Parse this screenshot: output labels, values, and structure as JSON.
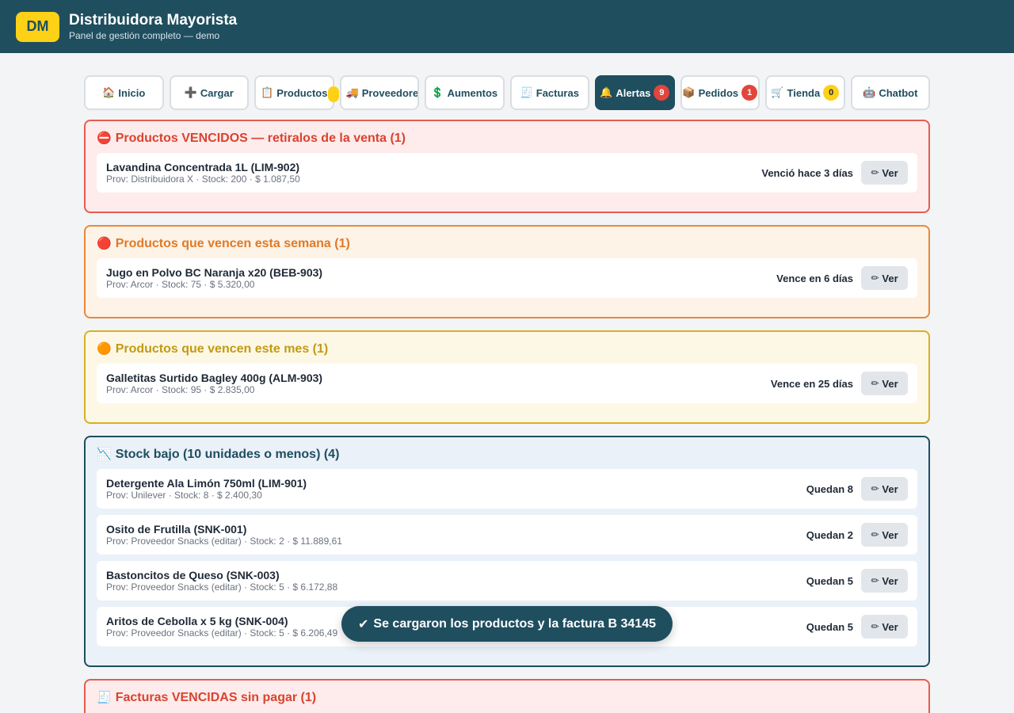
{
  "app": {
    "logo": "DM",
    "title": "Distribuidora Mayorista",
    "subtitle": "Panel de gestión completo — demo"
  },
  "nav": {
    "tabs": [
      {
        "icon": "🏠",
        "label": "Inicio"
      },
      {
        "icon": "➕",
        "label": "Cargar"
      },
      {
        "icon": "📋",
        "label": "Productos"
      },
      {
        "icon": "🚚",
        "label": "Proveedores"
      },
      {
        "icon": "💲",
        "label": "Aumentos"
      },
      {
        "icon": "🧾",
        "label": "Facturas"
      },
      {
        "icon": "🔔",
        "label": "Alertas",
        "badge": "9"
      },
      {
        "icon": "📦",
        "label": "Pedidos",
        "badge": "1"
      },
      {
        "icon": "🛒",
        "label": "Tienda",
        "badge": "0"
      },
      {
        "icon": "🤖",
        "label": "Chatbot"
      }
    ]
  },
  "sections": {
    "vencidos": {
      "icon": "⛔",
      "title": "Productos VENCIDOS — retiralos de la venta (1)",
      "items": [
        {
          "name": "Lavandina Concentrada 1L (LIM-902)",
          "meta": "Prov: Distribuidora X · Stock: 200 · $ 1.087,50",
          "status": "Venció hace 3 días"
        }
      ]
    },
    "semana": {
      "icon": "🔴",
      "title": "Productos que vencen esta semana (1)",
      "items": [
        {
          "name": "Jugo en Polvo BC Naranja x20 (BEB-903)",
          "meta": "Prov: Arcor · Stock: 75 · $ 5.320,00",
          "status": "Vence en 6 días"
        }
      ]
    },
    "mes": {
      "icon": "🟠",
      "title": "Productos que vencen este mes (1)",
      "items": [
        {
          "name": "Galletitas Surtido Bagley 400g (ALM-903)",
          "meta": "Prov: Arcor · Stock: 95 · $ 2.835,00",
          "status": "Vence en 25 días"
        }
      ]
    },
    "stock": {
      "icon": "📉",
      "title": "Stock bajo (10 unidades o menos) (4)",
      "items": [
        {
          "name": "Detergente Ala Limón 750ml (LIM-901)",
          "meta": "Prov: Unilever · Stock: 8 · $ 2.400,30",
          "status": "Quedan 8"
        },
        {
          "name": "Osito de Frutilla (SNK-001)",
          "meta": "Prov: Proveedor Snacks (editar) · Stock: 2 · $ 11.889,61",
          "status": "Quedan 2"
        },
        {
          "name": "Bastoncitos de Queso (SNK-003)",
          "meta": "Prov: Proveedor Snacks (editar) · Stock: 5 · $ 6.172,88",
          "status": "Quedan 5"
        },
        {
          "name": "Aritos de Cebolla x 5 kg (SNK-004)",
          "meta": "Prov: Proveedor Snacks (editar) · Stock: 5 · $ 6.206,49",
          "status": "Quedan 5"
        }
      ]
    },
    "facturas": {
      "icon": "🧾",
      "title": "Facturas VENCIDAS sin pagar (1)"
    }
  },
  "actions": {
    "view_icon": "✏",
    "view_label": "Ver"
  },
  "toast": {
    "icon": "✔",
    "message": "Se cargaron los productos y la factura B 34145"
  }
}
